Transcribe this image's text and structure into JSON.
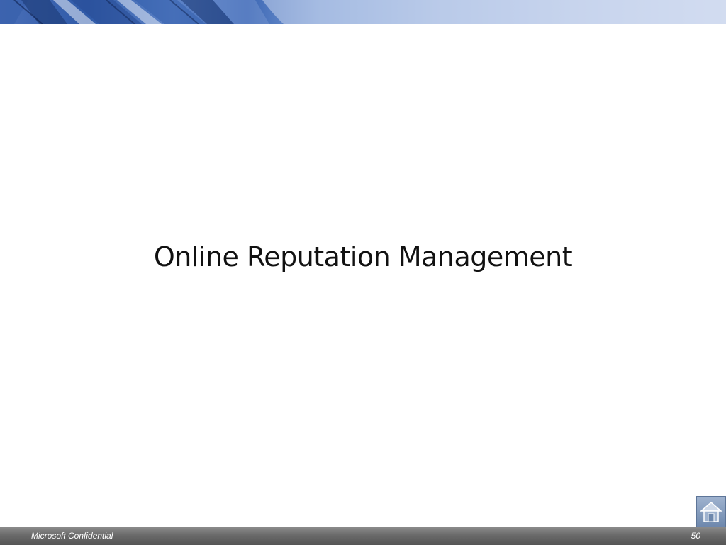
{
  "slide": {
    "title": "Online Reputation Management",
    "footer": {
      "confidential_label": "Microsoft Confidential",
      "page_number": "50"
    },
    "home_button": {
      "icon": "home-icon"
    }
  },
  "colors": {
    "banner_blue": "#2f5aa8",
    "banner_light": "#dfe6f4",
    "footer_gray": "#6a6a6a",
    "home_button": "#7f97b9",
    "title_text": "#111111"
  }
}
